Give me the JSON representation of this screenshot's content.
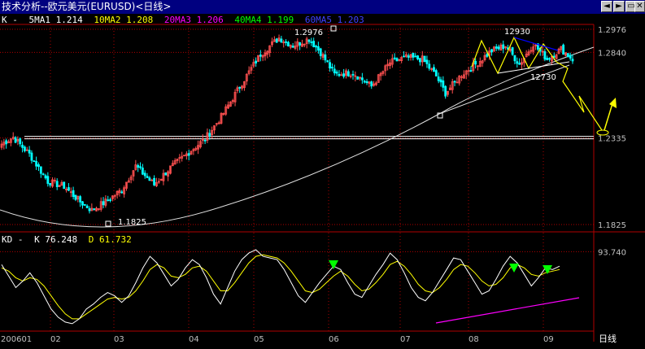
{
  "window": {
    "title": "技术分析--欧元美元(EURUSD)<日线>",
    "buttons": [
      {
        "name": "back-button",
        "glyph": "◄"
      },
      {
        "name": "forward-button",
        "glyph": "►"
      },
      {
        "name": "restore-button",
        "glyph": "▭"
      },
      {
        "name": "close-button",
        "glyph": "✕"
      }
    ]
  },
  "legend": {
    "kind": "K -",
    "items": [
      {
        "label": "5MA1",
        "value": "1.214",
        "color": "#ffffff"
      },
      {
        "label": "10MA2",
        "value": "1.208",
        "color": "#ffff00"
      },
      {
        "label": "20MA3",
        "value": "1.206",
        "color": "#ff00ff"
      },
      {
        "label": "40MA4",
        "value": "1.199",
        "color": "#00ff00"
      },
      {
        "label": "60MA5",
        "value": "1.203",
        "color": "#0000ff"
      }
    ]
  },
  "kd_legend": {
    "kind": "KD -",
    "k_label": "K",
    "k_value": "76.248",
    "d_label": "D",
    "d_value": "61.732"
  },
  "colors": {
    "up": "#ff5050",
    "down": "#00ffff",
    "grid": "#b00000",
    "axis_text": "#c0c0c0",
    "k_line": "#ffffff",
    "d_line": "#ffff00",
    "arrow": "#00ff00",
    "projection": "#ffff00",
    "neckline": "#0000ff",
    "divergence": "#ff00ff"
  },
  "chart_data": [
    {
      "type": "candlestick",
      "title": "技术分析--欧元美元(EURUSD)<日线>",
      "ylim": [
        1.175,
        1.3
      ],
      "y_ticks": [
        "1.2976",
        "1.2840",
        "1.2335",
        "1.1825"
      ],
      "x_ticks": [
        "200601",
        "02",
        "03",
        "04",
        "05",
        "06",
        "07",
        "08",
        "09"
      ],
      "x_period_label": "日线",
      "grid": true,
      "anchors": [
        [
          0,
          1.23
        ],
        [
          5,
          1.234
        ],
        [
          12,
          1.224
        ],
        [
          20,
          1.208
        ],
        [
          27,
          1.205
        ],
        [
          34,
          1.196
        ],
        [
          39,
          1.191
        ],
        [
          45,
          1.196
        ],
        [
          52,
          1.203
        ],
        [
          58,
          1.217
        ],
        [
          66,
          1.206
        ],
        [
          73,
          1.216
        ],
        [
          80,
          1.224
        ],
        [
          88,
          1.233
        ],
        [
          95,
          1.246
        ],
        [
          104,
          1.266
        ],
        [
          112,
          1.283
        ],
        [
          120,
          1.2925
        ],
        [
          126,
          1.288
        ],
        [
          133,
          1.292
        ],
        [
          138,
          1.284
        ],
        [
          144,
          1.271
        ],
        [
          152,
          1.272
        ],
        [
          160,
          1.264
        ],
        [
          168,
          1.278
        ],
        [
          175,
          1.281
        ],
        [
          182,
          1.28
        ],
        [
          188,
          1.27
        ],
        [
          192,
          1.26
        ],
        [
          199,
          1.271
        ],
        [
          206,
          1.278
        ],
        [
          212,
          1.285
        ],
        [
          218,
          1.288
        ],
        [
          224,
          1.277
        ],
        [
          230,
          1.289
        ],
        [
          236,
          1.28
        ],
        [
          242,
          1.286
        ],
        [
          247,
          1.28
        ]
      ],
      "annotations": [
        {
          "text": "1.2976",
          "x": "high-may",
          "y": 1.2976
        },
        {
          "text": "1.1825",
          "x": "low-march",
          "y": 1.1825
        },
        {
          "text": "12930",
          "x": "top-1",
          "y": 1.293
        },
        {
          "text": "12730",
          "x": "neckline",
          "y": 1.273
        }
      ],
      "support_level": 1.2335,
      "projection_path": [
        [
          1.282,
          "now"
        ],
        [
          1.26
        ],
        [
          1.242
        ],
        [
          1.2335
        ],
        [
          1.253
        ]
      ]
    },
    {
      "type": "line",
      "title": "KD",
      "ylim": [
        0,
        100
      ],
      "y_ticks": [
        "93.740"
      ],
      "series": [
        {
          "name": "K",
          "values": [
            78,
            64,
            50,
            58,
            68,
            56,
            40,
            24,
            14,
            8,
            6,
            12,
            24,
            30,
            38,
            44,
            40,
            32,
            40,
            56,
            74,
            88,
            80,
            66,
            52,
            60,
            74,
            84,
            78,
            62,
            42,
            30,
            50,
            70,
            84,
            92,
            96,
            88,
            86,
            84,
            72,
            56,
            40,
            32,
            44,
            56,
            66,
            76,
            72,
            56,
            42,
            38,
            52,
            66,
            78,
            92,
            84,
            68,
            50,
            38,
            34,
            44,
            58,
            72,
            86,
            84,
            70,
            56,
            42,
            46,
            60,
            76,
            88,
            80,
            66,
            52,
            62,
            74,
            72,
            76
          ]
        },
        {
          "name": "D",
          "values": [
            74,
            70,
            62,
            58,
            62,
            60,
            52,
            40,
            28,
            18,
            12,
            12,
            18,
            24,
            30,
            36,
            38,
            36,
            38,
            46,
            58,
            72,
            78,
            74,
            64,
            62,
            66,
            74,
            76,
            70,
            58,
            46,
            46,
            56,
            68,
            80,
            88,
            90,
            88,
            86,
            80,
            70,
            58,
            46,
            44,
            48,
            56,
            64,
            70,
            64,
            54,
            46,
            48,
            56,
            66,
            78,
            82,
            76,
            66,
            54,
            46,
            44,
            50,
            60,
            72,
            78,
            76,
            68,
            58,
            52,
            54,
            62,
            74,
            78,
            74,
            66,
            64,
            68,
            70,
            72
          ]
        }
      ],
      "signal_arrows": 3
    }
  ]
}
